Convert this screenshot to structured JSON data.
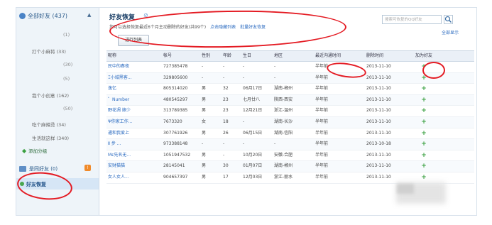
{
  "sidebar": {
    "header": "全部好友 (437)",
    "items": [
      {
        "label": "(1)",
        "kind": "count"
      },
      {
        "label": "打个小麻将 (33)",
        "kind": "group"
      },
      {
        "label": "(30)",
        "kind": "count"
      },
      {
        "label": "(5)",
        "kind": "count"
      },
      {
        "label": "我个小创意 (162)",
        "kind": "group"
      },
      {
        "label": "(50)",
        "kind": "count"
      },
      {
        "label": "吃个麻辣烫 (34)",
        "kind": "group"
      },
      {
        "label": "生活就这样 (340)",
        "kind": "group"
      }
    ],
    "add_group": "添加分组",
    "strangers": "是同好友 (0)",
    "selected": "好友恢复"
  },
  "main": {
    "title": "好友恢复",
    "description": "您可以选择恢复最近6个月主动删除的好友(共99个)",
    "link_hide": "点击隐藏列表",
    "link_batch": "批量好友恢复",
    "button_label": "进行列表",
    "search_placeholder": "搜索可恢复的QQ好友",
    "show_all": "全部显示"
  },
  "table": {
    "columns": [
      "昵称",
      "帐号",
      "性别",
      "年龄",
      "生日",
      "地区",
      "最近沟通时间",
      "删除时间",
      "加为好友"
    ],
    "rows": [
      [
        "民中的春夜",
        "727385478",
        "-",
        "-",
        "-",
        "-",
        "半年前",
        "2013-11-10",
        "+"
      ],
      [
        "Ξ小城黑客...",
        "329805600",
        "-",
        "-",
        "-",
        "-",
        "半年前",
        "2013-11-10",
        "+"
      ],
      [
        "逸忆",
        "805314020",
        "男",
        "32",
        "06月17日",
        "湖南-郴州",
        "半年前",
        "2013-11-10",
        "+"
      ],
      [
        "゜Number",
        "480545297",
        "男",
        "23",
        "七月廿八",
        "陕西-西安",
        "半年前",
        "2013-11-10",
        "+"
      ],
      [
        "野花凋 嫁少",
        "313789385",
        "男",
        "23",
        "12月21日",
        "浙江-温州",
        "半年前",
        "2013-11-10",
        "+"
      ],
      [
        "Ψ你家工作...",
        "7673320",
        "女",
        "18",
        "-",
        "湖南-长沙",
        "半年前",
        "2013-11-10",
        "+"
      ],
      [
        "通和我爱上",
        "307761926",
        "男",
        "26",
        "06月15日",
        "湖南-信阳",
        "半年前",
        "2013-11-10",
        "+"
      ],
      [
        "Ⅱ 步 ...",
        "973388148",
        "-",
        "-",
        "-",
        "-",
        "半年前",
        "2013-10-18",
        "+"
      ],
      [
        "Mε先名无...",
        "1051947532",
        "男",
        "-",
        "10月20日",
        "安徽-合肥",
        "半年前",
        "2013-11-10",
        "+"
      ],
      [
        "安财猫猫",
        "28145041",
        "男",
        "30",
        "01月07日",
        "湖南-郴州",
        "半年前",
        "2013-11-10",
        "+"
      ],
      [
        "女人女人...",
        "904657397",
        "男",
        "17",
        "12月03日",
        "浙江-丽水",
        "半年前",
        "2013-11-10",
        "+"
      ]
    ]
  }
}
